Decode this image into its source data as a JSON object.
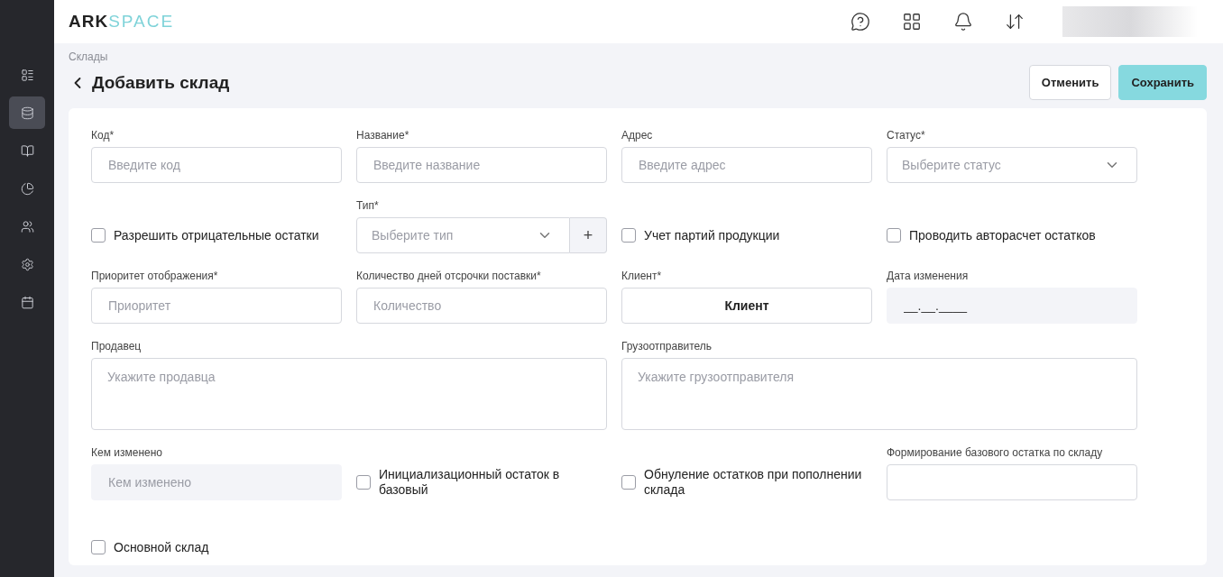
{
  "logo": {
    "bold": "ARK",
    "light": "SPACE"
  },
  "sidebar": {
    "items": [
      {
        "selected": false
      },
      {
        "selected": true
      },
      {
        "selected": false
      },
      {
        "selected": false
      },
      {
        "selected": false
      },
      {
        "selected": false
      },
      {
        "selected": false
      }
    ]
  },
  "breadcrumb": "Склады",
  "title": "Добавить склад",
  "buttons": {
    "cancel": "Отменить",
    "save": "Сохранить"
  },
  "fields": [
    {
      "kind": "input",
      "label": "Код*",
      "placeholder": "Введите код"
    },
    {
      "kind": "input",
      "label": "Название*",
      "placeholder": "Введите название"
    },
    {
      "kind": "input",
      "label": "Адрес",
      "placeholder": "Введите адрес"
    },
    {
      "kind": "select",
      "label": "Статус*",
      "placeholder": "Выберите статус"
    },
    {
      "kind": "checkbox",
      "label": "Разрешить отрицательные остатки",
      "checked": false
    },
    {
      "kind": "select-add",
      "label": "Тип*",
      "placeholder": "Выберите тип",
      "add": "+"
    },
    {
      "kind": "checkbox",
      "label": "Учет партий продукции",
      "checked": false
    },
    {
      "kind": "checkbox",
      "label": "Проводить авторасчет остатков",
      "checked": false
    },
    {
      "kind": "input",
      "label": "Приоритет отображения*",
      "placeholder": "Приоритет"
    },
    {
      "kind": "input",
      "label": "Количество дней отсрочки поставки*",
      "placeholder": "Количество"
    },
    {
      "kind": "button",
      "label": "Клиент*",
      "value": "Клиент"
    },
    {
      "kind": "readonly",
      "label": "Дата изменения",
      "value": "__.__.____"
    },
    {
      "kind": "textarea",
      "label": "Продавец",
      "placeholder": "Укажите продавца"
    },
    {
      "kind": "textarea",
      "label": "Грузоотправитель",
      "placeholder": "Укажите грузоотправителя"
    },
    {
      "kind": "readonly",
      "label": "Кем изменено",
      "placeholder": "Кем изменено"
    },
    {
      "kind": "checkbox",
      "label": "Инициализационный остаток в базовый",
      "checked": false
    },
    {
      "kind": "checkbox",
      "label": "Обнуление остатков при пополнении склада",
      "checked": false
    },
    {
      "kind": "input",
      "label": "Формирование базового остатка по складу"
    },
    {
      "kind": "checkbox",
      "label": "Основной склад",
      "checked": false
    }
  ]
}
